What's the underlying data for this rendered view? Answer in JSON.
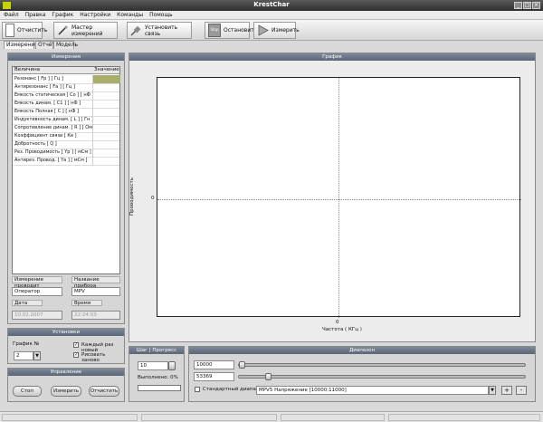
{
  "window": {
    "title": "KrestChar"
  },
  "menu": [
    "Файл",
    "Правка",
    "График",
    "Настройки",
    "Команды",
    "Помощь"
  ],
  "toolbar": {
    "report": "Отчистить",
    "wizard": "Мастер измерений",
    "connect": "Установить связь",
    "stop_icon": "Stop",
    "stop": "Остановить",
    "measure": "Измерить"
  },
  "tabs": [
    "Измерение",
    "Отчёт",
    "Модель"
  ],
  "measure_panel": {
    "title": "Измерения",
    "columns": [
      "Величина",
      "Значение"
    ],
    "rows": [
      "Резонанс             [ Fр ] [ Гц ]",
      "Антирезонанс      [ Fа ] [ Гц ]",
      "Емкость статическая [ Со ] [ нФ ]",
      "Емкость динам.   [ С1 ] [ нФ ]",
      "Емкость Полная   [ С ] [ нФ ]",
      "Индуктивность динам. [ L ] [ Гн ]",
      "Сопротивление динам. [ R ] [ Ом ]",
      "Коэффициент связи   [ Ке ]",
      "Добротность          [ Q ]",
      "Рез. Проводимость  [ Yр ] [ мСм ]",
      "Антирез. Провод.  [ Yа ] [ мСм ]"
    ],
    "operator_label": "Измерение проводит",
    "operator_value": "Оператор",
    "device_label": "Название прибора",
    "device_value": "MPV",
    "date_label": "Дата",
    "date_value": "10.02.2007",
    "time_label": "Время",
    "time_value": "22:24:03"
  },
  "settings_panel": {
    "title": "Установки",
    "graph_label": "График №",
    "graph_value": "2",
    "check_new": "Каждый раз новый",
    "check_redraw": "Рисовать заново"
  },
  "control_panel": {
    "title": "Управление",
    "stop": "Стоп",
    "measure": "Измерить",
    "clear": "Отчистить"
  },
  "graph_panel": {
    "title": "График",
    "ylabel": "Проводимость",
    "xlabel": "Частота ( КГц )",
    "y_tick": "0",
    "x_tick": "0"
  },
  "step_panel": {
    "title": "Шаг | Прогресс",
    "step_value": "10",
    "progress_text": "Выполнено: 0%",
    "progress": 0
  },
  "range_panel": {
    "title": "Диапазон",
    "from_value": "10000",
    "to_value": "53369",
    "standard_label": "Стандартный диапазон",
    "range_select": "MPV5 Напряжение [10000;11000]",
    "plus": "+",
    "minus": "-"
  }
}
